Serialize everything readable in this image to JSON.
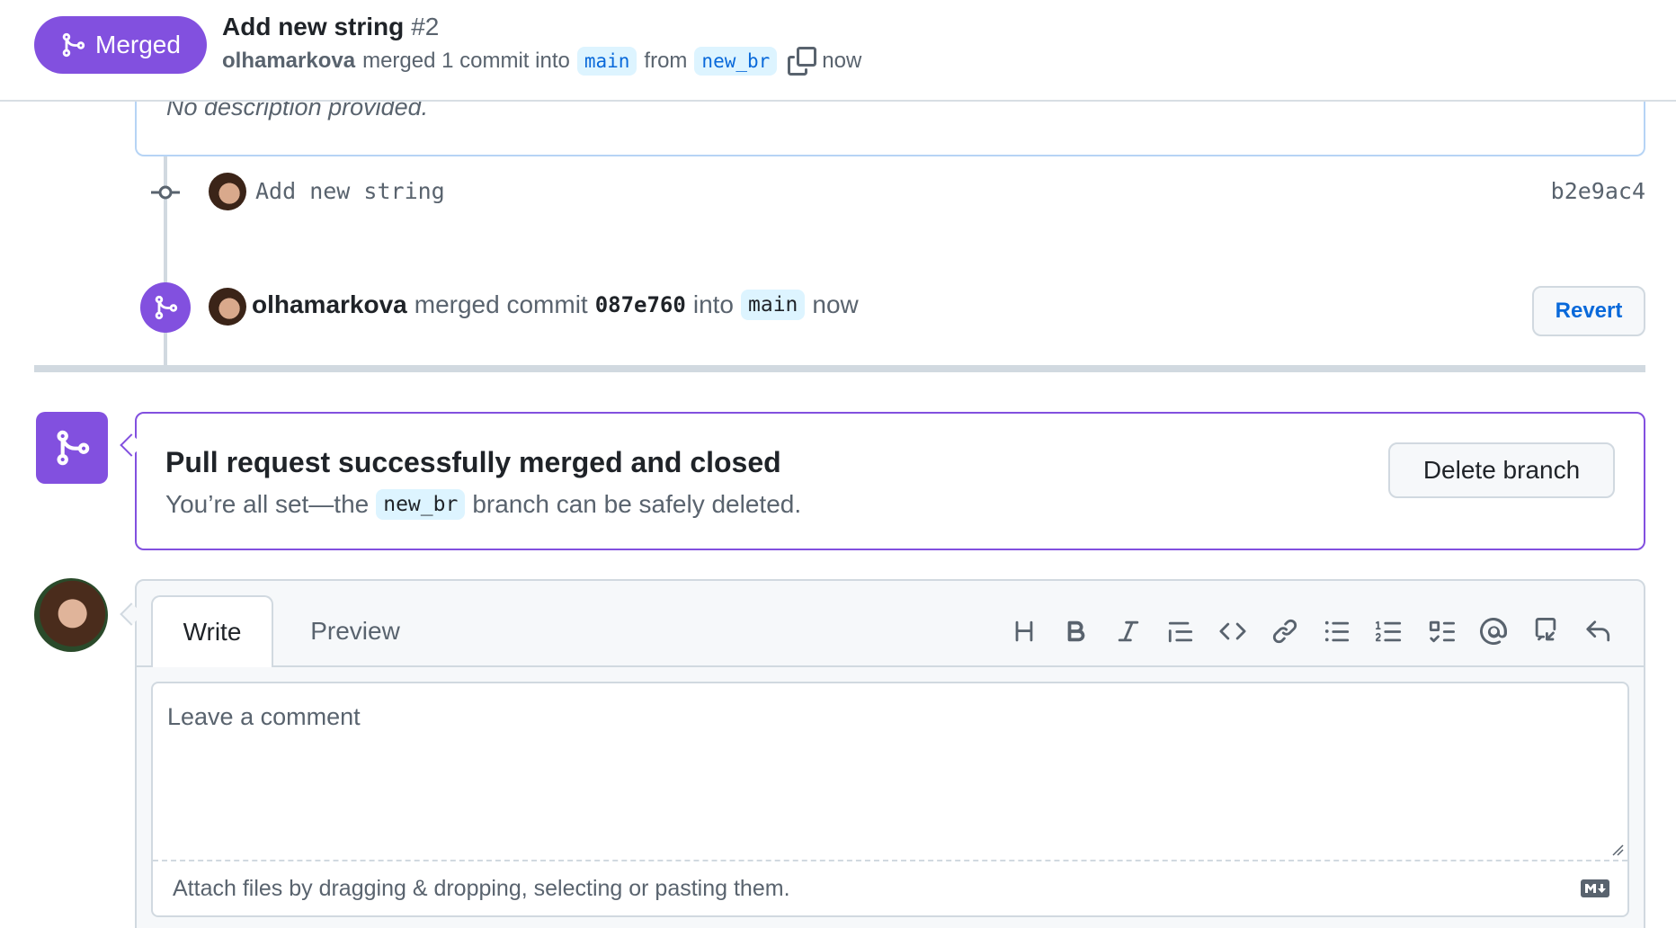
{
  "header": {
    "status_label": "Merged",
    "title": "Add new string",
    "number": "#2",
    "author": "olhamarkova",
    "merged_text": "merged 1 commit into",
    "base_branch": "main",
    "from_text": "from",
    "head_branch": "new_br",
    "time": "now"
  },
  "description": {
    "text": "No description provided."
  },
  "commit": {
    "message": "Add new string",
    "sha": "b2e9ac4"
  },
  "merge_event": {
    "author": "olhamarkova",
    "text": "merged commit",
    "sha": "087e760",
    "into_text": "into",
    "branch": "main",
    "time": "now",
    "revert_label": "Revert"
  },
  "merge_box": {
    "title": "Pull request successfully merged and closed",
    "sub_prefix": "You’re all set—the",
    "branch": "new_br",
    "sub_suffix": "branch can be safely deleted.",
    "delete_label": "Delete branch"
  },
  "comment": {
    "tab_write": "Write",
    "tab_preview": "Preview",
    "placeholder": "Leave a comment",
    "attach_text": "Attach files by dragging & dropping, selecting or pasting them.",
    "toolbar_icons": [
      "heading-icon",
      "bold-icon",
      "italic-icon",
      "quote-icon",
      "code-icon",
      "link-icon",
      "unordered-list-icon",
      "ordered-list-icon",
      "task-list-icon",
      "mention-icon",
      "cross-reference-icon",
      "reply-icon"
    ]
  },
  "colors": {
    "merged_purple": "#8250df",
    "link_blue": "#0969da",
    "branch_bg": "#ddf4ff",
    "border": "#d1d9e0"
  }
}
